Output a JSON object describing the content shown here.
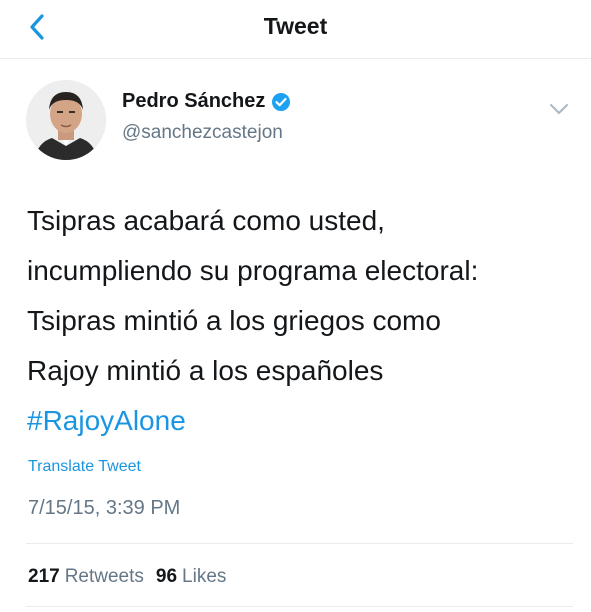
{
  "header": {
    "title": "Tweet"
  },
  "author": {
    "name": "Pedro Sánchez",
    "handle": "@sanchezcastejon"
  },
  "tweet": {
    "lines": [
      "Tsipras acabará como usted,",
      "incumpliendo su programa electoral:",
      "Tsipras mintió a los griegos como",
      "Rajoy mintió a los españoles"
    ],
    "hashtag": "#RajoyAlone"
  },
  "translate_label": "Translate Tweet",
  "timestamp": "7/15/15, 3:39 PM",
  "stats": {
    "retweets_count": "217",
    "retweets_label": "Retweets",
    "likes_count": "96",
    "likes_label": "Likes"
  },
  "colors": {
    "accent": "#1b95e0",
    "muted": "#657786",
    "text": "#14171a"
  },
  "icons": [
    "back-arrow-icon",
    "verified-badge-icon",
    "chevron-down-icon"
  ]
}
